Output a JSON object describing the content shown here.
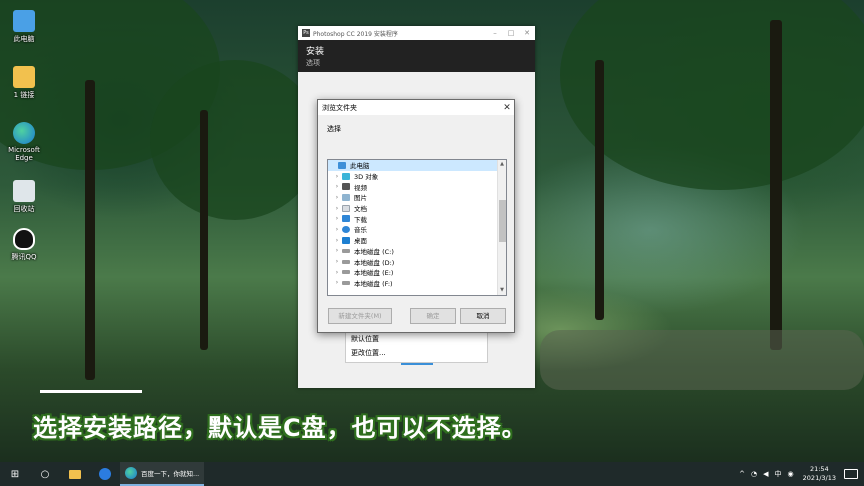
{
  "desktop": {
    "icons": [
      {
        "label": "此电脑"
      },
      {
        "label": "1 链接"
      },
      {
        "label": "Microsoft Edge"
      },
      {
        "label": "回收站"
      },
      {
        "label": "腾讯QQ"
      }
    ]
  },
  "installer": {
    "title": "Photoshop CC 2019 安装程序",
    "header_title": "安装",
    "header_subtitle": "选项",
    "menu": {
      "items": [
        "默认位置",
        "更改位置..."
      ]
    }
  },
  "dialog": {
    "title": "浏览文件夹",
    "close_glyph": "✕",
    "prompt": "选择",
    "tree": [
      {
        "label": "此电脑",
        "icon": "computer-icon",
        "expandable": false,
        "selected": true
      },
      {
        "label": "3D 对象",
        "icon": "3d-objects-icon",
        "expandable": true
      },
      {
        "label": "视频",
        "icon": "video-folder-icon",
        "expandable": true
      },
      {
        "label": "图片",
        "icon": "pictures-folder-icon",
        "expandable": true
      },
      {
        "label": "文档",
        "icon": "documents-folder-icon",
        "expandable": true
      },
      {
        "label": "下载",
        "icon": "download-folder-icon",
        "expandable": true
      },
      {
        "label": "音乐",
        "icon": "music-folder-icon",
        "expandable": true
      },
      {
        "label": "桌面",
        "icon": "desktop-folder-icon",
        "expandable": true
      },
      {
        "label": "本地磁盘 (C:)",
        "icon": "drive-icon",
        "expandable": true
      },
      {
        "label": "本地磁盘 (D:)",
        "icon": "drive-icon",
        "expandable": true
      },
      {
        "label": "本地磁盘 (E:)",
        "icon": "drive-icon",
        "expandable": true
      },
      {
        "label": "本地磁盘 (F:)",
        "icon": "drive-icon",
        "expandable": true
      }
    ],
    "buttons": {
      "new_folder": "新建文件夹(M)",
      "ok": "确定",
      "cancel": "取消"
    }
  },
  "caption": "选择安装路径，默认是C盘，也可以不选择。",
  "taskbar": {
    "start_glyph": "⊞",
    "search_glyph": "○",
    "app_label": "百度一下，你就知...",
    "tray": {
      "chevron": "^",
      "ime": "中",
      "time": "21:54",
      "date": "2021/3/13"
    }
  },
  "colors": {
    "caption_outline": "#2f6e1e",
    "selected_row": "#cce8ff",
    "installer_header": "#222222"
  }
}
